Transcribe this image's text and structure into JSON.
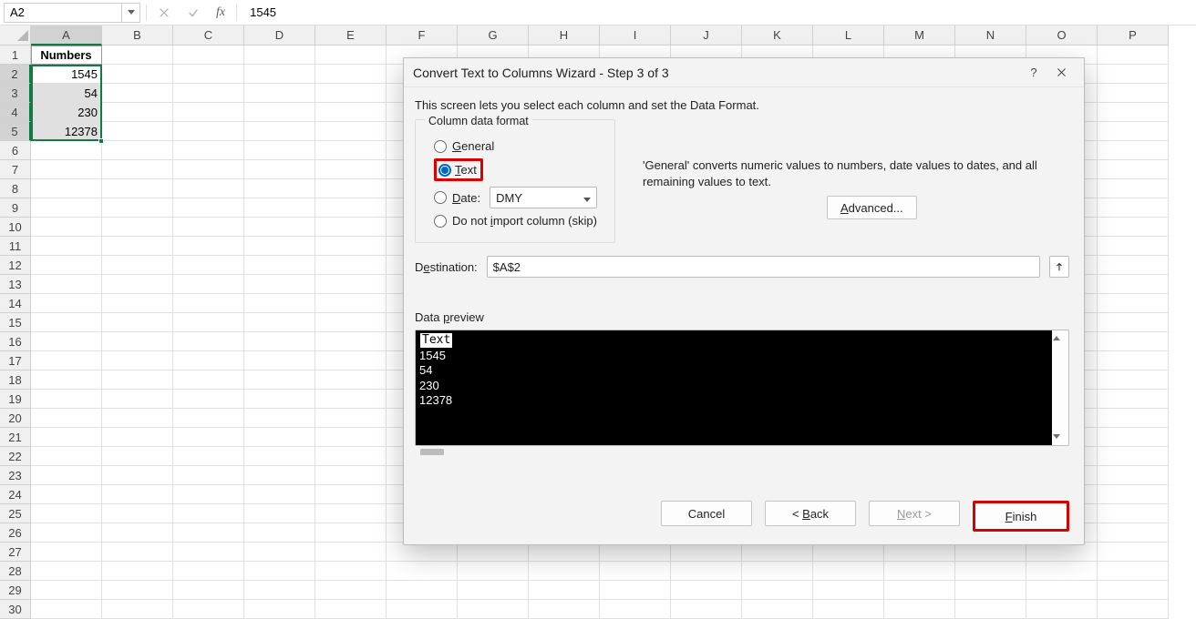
{
  "namebox": {
    "value": "A2"
  },
  "formula_bar": {
    "fx_label": "fx",
    "value": "1545"
  },
  "columns": [
    "A",
    "B",
    "C",
    "D",
    "E",
    "F",
    "G",
    "H",
    "I",
    "J",
    "K",
    "L",
    "M",
    "N",
    "O",
    "P"
  ],
  "rows_count": 30,
  "selected_col_index": 0,
  "selected_row_start": 2,
  "selected_row_end": 5,
  "sheet": {
    "A1": "Numbers",
    "A2": "1545",
    "A3": "54",
    "A4": "230",
    "A5": "12378"
  },
  "dialog": {
    "title": "Convert Text to Columns Wizard - Step 3 of 3",
    "help_tooltip": "?",
    "desc": "This screen lets you select each column and set the Data Format.",
    "format_group_label": "Column data format",
    "opts": {
      "general": "General",
      "text": "Text",
      "date": "Date:",
      "skip": "Do not import column (skip)"
    },
    "date_format": "DMY",
    "info_text": "'General' converts numeric values to numbers, date values to dates, and all remaining values to text.",
    "advanced_label": "Advanced...",
    "destination_label": "Destination:",
    "destination_value": "$A$2",
    "preview_label": "Data preview",
    "preview_header": "Text",
    "preview_rows": [
      "1545",
      "54",
      "230",
      "12378"
    ],
    "buttons": {
      "cancel": "Cancel",
      "back": "< Back",
      "next": "Next >",
      "finish": "Finish"
    }
  }
}
